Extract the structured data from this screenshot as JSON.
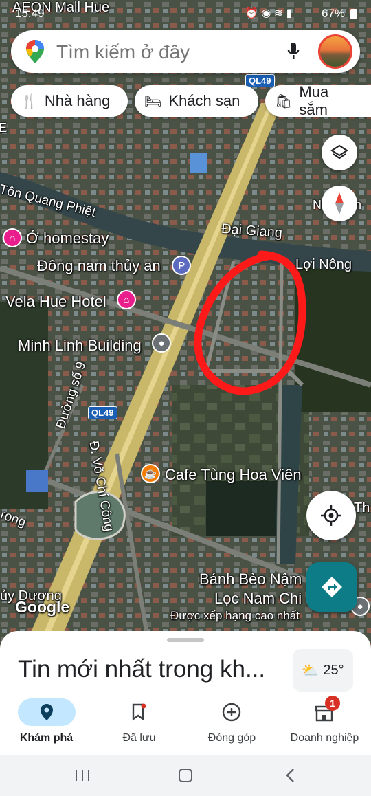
{
  "status_bar": {
    "time": "15:49",
    "battery": "67%"
  },
  "search": {
    "placeholder": "Tìm kiếm ở đây"
  },
  "chips": [
    {
      "label": "Nhà hàng",
      "icon": "fork-knife-icon"
    },
    {
      "label": "Khách sạn",
      "icon": "bed-icon"
    },
    {
      "label": "Mua sắm",
      "icon": "shopping-bag-icon"
    }
  ],
  "map_labels": {
    "top_partial": "AEON Mall Hue",
    "ton_quang_phiet": "Tôn Quang Phiệt",
    "dai_giang": "Đại Giang",
    "loi_nong": "Lợi Nông",
    "right_partial": "N  n Ho  n",
    "homestay": "Ở homestay",
    "dong_nam": "Đông nam thủy an",
    "vela": "Vela Hue Hotel",
    "minh_linh": "Minh Linh Building",
    "duong_so_9": "Đường số 9",
    "vo_chi_cong": "Đ. Võ Chí Công",
    "cafe": "Cafe Tùng Hoa Viên",
    "banh_beo_1": "Bánh Bèo Nậm",
    "banh_beo_2": "Lọc Nam Chi",
    "ranked": "Được xếp hạng cao nhất",
    "thuy_duong": "ủy Dương",
    "truong": "rong",
    "google": "Google",
    "th": "Th",
    "e_partial": "E",
    "road_shield": "QL49"
  },
  "sheet": {
    "title": "Tin mới nhất trong kh...",
    "weather_temp": "25°"
  },
  "nav": [
    {
      "label": "Khám phá",
      "icon": "explore-pin-icon",
      "active": true
    },
    {
      "label": "Đã lưu",
      "icon": "bookmark-icon",
      "active": false
    },
    {
      "label": "Đóng góp",
      "icon": "add-circle-icon",
      "active": false
    },
    {
      "label": "Doanh nghiệp",
      "icon": "store-icon",
      "active": false,
      "badge": "1"
    }
  ],
  "colors": {
    "accent": "#1a73e8",
    "marker_red": "#ff1a1a",
    "directions": "#0e7c86"
  }
}
